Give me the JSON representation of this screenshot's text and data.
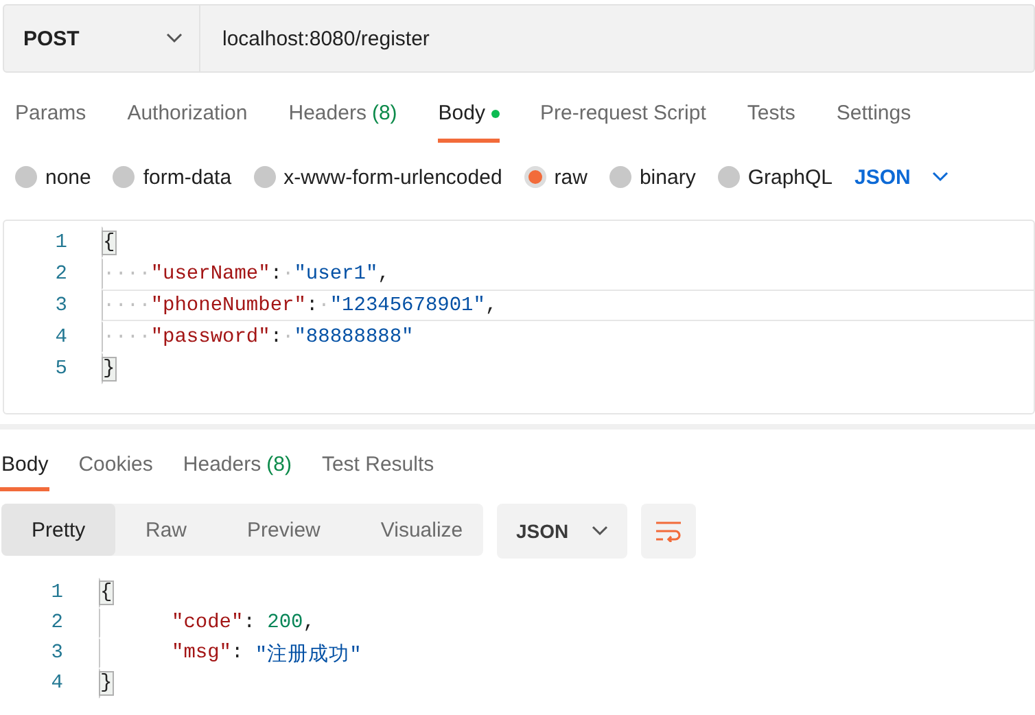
{
  "request": {
    "method": "POST",
    "url": "localhost:8080/register"
  },
  "request_tabs": [
    {
      "label": "Params",
      "selected": false,
      "has_content": false
    },
    {
      "label": "Authorization",
      "selected": false,
      "has_content": false
    },
    {
      "label": "Headers",
      "count": "(8)",
      "selected": false,
      "has_content": false
    },
    {
      "label": "Body",
      "selected": true,
      "has_content": true
    },
    {
      "label": "Pre-request Script",
      "selected": false,
      "has_content": false
    },
    {
      "label": "Tests",
      "selected": false,
      "has_content": false
    },
    {
      "label": "Settings",
      "selected": false,
      "has_content": false
    }
  ],
  "body_types": [
    {
      "label": "none",
      "selected": false
    },
    {
      "label": "form-data",
      "selected": false
    },
    {
      "label": "x-www-form-urlencoded",
      "selected": false
    },
    {
      "label": "raw",
      "selected": true
    },
    {
      "label": "binary",
      "selected": false
    },
    {
      "label": "GraphQL",
      "selected": false
    }
  ],
  "body_format": "JSON",
  "request_editor": [
    {
      "number": "1",
      "active": false,
      "tokens": [
        {
          "kind": "bracket",
          "text": "{"
        }
      ]
    },
    {
      "number": "2",
      "active": false,
      "tokens": [
        {
          "kind": "ws",
          "text": "····"
        },
        {
          "kind": "key",
          "text": "\"userName\""
        },
        {
          "kind": "punct",
          "text": ":"
        },
        {
          "kind": "ws",
          "text": "·"
        },
        {
          "kind": "string",
          "text": "\"user1\""
        },
        {
          "kind": "punct",
          "text": ","
        }
      ]
    },
    {
      "number": "3",
      "active": true,
      "tokens": [
        {
          "kind": "ws",
          "text": "····"
        },
        {
          "kind": "key",
          "text": "\"phoneNumber\""
        },
        {
          "kind": "punct",
          "text": ":"
        },
        {
          "kind": "ws",
          "text": "·"
        },
        {
          "kind": "string",
          "text": "\"12345678901\""
        },
        {
          "kind": "punct",
          "text": ","
        }
      ]
    },
    {
      "number": "4",
      "active": false,
      "tokens": [
        {
          "kind": "ws",
          "text": "····"
        },
        {
          "kind": "key",
          "text": "\"password\""
        },
        {
          "kind": "punct",
          "text": ":"
        },
        {
          "kind": "ws",
          "text": "·"
        },
        {
          "kind": "string",
          "text": "\"88888888\""
        }
      ]
    },
    {
      "number": "5",
      "active": false,
      "tokens": [
        {
          "kind": "bracket",
          "text": "}"
        }
      ]
    }
  ],
  "response_tabs": [
    {
      "label": "Body",
      "selected": true
    },
    {
      "label": "Cookies",
      "selected": false
    },
    {
      "label": "Headers",
      "count": "(8)",
      "selected": false
    },
    {
      "label": "Test Results",
      "selected": false
    }
  ],
  "view_modes": [
    {
      "label": "Pretty",
      "selected": true
    },
    {
      "label": "Raw",
      "selected": false
    },
    {
      "label": "Preview",
      "selected": false
    },
    {
      "label": "Visualize",
      "selected": false
    }
  ],
  "response_format": "JSON",
  "response_editor": [
    {
      "number": "1",
      "active": false,
      "tokens": [
        {
          "kind": "bracket",
          "text": "{"
        }
      ]
    },
    {
      "number": "2",
      "active": false,
      "tokens": [
        {
          "kind": "indent"
        },
        {
          "kind": "key",
          "text": "\"code\""
        },
        {
          "kind": "punct",
          "text": ": "
        },
        {
          "kind": "number",
          "text": "200"
        },
        {
          "kind": "punct",
          "text": ","
        }
      ]
    },
    {
      "number": "3",
      "active": false,
      "tokens": [
        {
          "kind": "indent"
        },
        {
          "kind": "key",
          "text": "\"msg\""
        },
        {
          "kind": "punct",
          "text": ": "
        },
        {
          "kind": "string",
          "text": "\"注册成功\""
        }
      ]
    },
    {
      "number": "4",
      "active": false,
      "tokens": [
        {
          "kind": "bracket",
          "text": "}"
        }
      ]
    }
  ]
}
